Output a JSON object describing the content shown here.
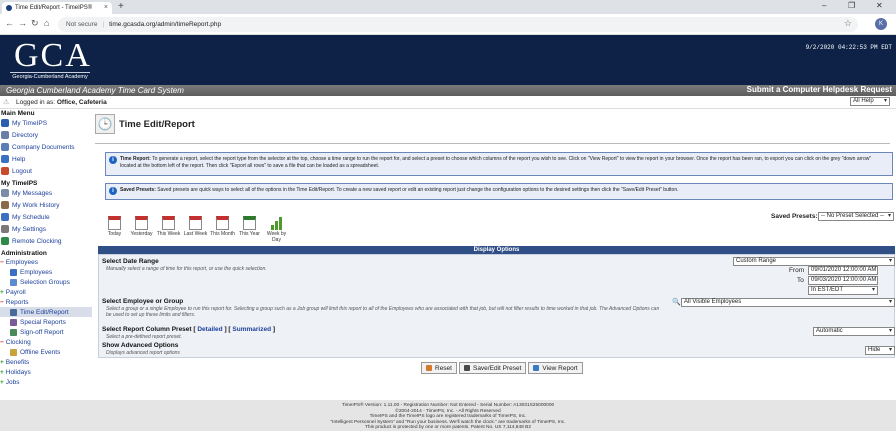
{
  "browser": {
    "tab_title": "Time Edit/Report - TimeIPS®",
    "tab_close": "×",
    "new_tab": "+",
    "win_min": "–",
    "win_max": "❐",
    "win_close": "✕",
    "back": "←",
    "forward": "→",
    "reload": "↻",
    "home": "⌂",
    "security": "Not secure",
    "url": "time.gcasda.org/admin/timeReport.php",
    "star": "☆",
    "profile_initial": "K"
  },
  "header": {
    "logo_text": "GCA",
    "logo_subtitle": "Georgia-Cumberland Academy",
    "datetime": "9/2/2020 04:22:53 PM EDT",
    "system_title": "Georgia Cumberland Academy Time Card System",
    "helpdesk_link": "Submit a Computer Helpdesk Request"
  },
  "login": {
    "warning": "⚠",
    "prefix": "Logged in as:",
    "user": "Office, Cafeteria",
    "help_select": "All Help"
  },
  "sidebar": {
    "main_menu": "Main Menu",
    "main_items": [
      {
        "label": "My TimeIPS",
        "color": "#2a5db0"
      },
      {
        "label": "Directory",
        "color": "#6a7fa8"
      },
      {
        "label": "Company Documents",
        "color": "#5b7fb5"
      },
      {
        "label": "Help",
        "color": "#3a6fc4"
      },
      {
        "label": "Logout",
        "color": "#c94a2a"
      }
    ],
    "my_timeips": "My TimeIPS",
    "my_items": [
      {
        "label": "My Messages",
        "color": "#7a8ca8"
      },
      {
        "label": "My Work History",
        "color": "#8a6a4a"
      },
      {
        "label": "My Schedule",
        "color": "#3a6fc4"
      },
      {
        "label": "My Settings",
        "color": "#7a7a7a"
      },
      {
        "label": "Remote Clocking",
        "color": "#2f8a4a"
      }
    ],
    "administration": "Administration",
    "employees": "Employees",
    "employees_sub": [
      "Employees",
      "Selection Groups"
    ],
    "payroll": "Payroll",
    "reports": "Reports",
    "reports_sub": [
      "Time Edit/Report",
      "Special Reports",
      "Sign-off Report"
    ],
    "clocking": "Clocking",
    "clocking_sub": [
      "Offline Events"
    ],
    "benefits": "Benefits",
    "holidays": "Holidays",
    "jobs": "Jobs"
  },
  "page": {
    "title": "Time Edit/Report",
    "info1_label": "Time Report:",
    "info1_text": "To generate a report, select the report type from the selector at the top, choose a time range to run the report for, and select a preset to choose which columns of the report you wish to see. Click on \"View Report\" to view the report in your browser. Once the report has been ran, to export you can click on the grey \"down arrow\" located at the bottom left of the report. Then click \"Export all rows\" to save a file that can be loaded as a spreadsheet.",
    "info2_label": "Saved Presets:",
    "info2_text": "Saved presets are quick ways to select all of the options in the Time Edit/Report. To create a new saved report or edit an existing report just change the configuration options to the desired settings then click the \"Save/Edit Preset\" button.",
    "presets": [
      {
        "label": "Today",
        "style": "red"
      },
      {
        "label": "Yesterday",
        "style": "red"
      },
      {
        "label": "This Week",
        "style": "red"
      },
      {
        "label": "Last Week",
        "style": "red"
      },
      {
        "label": "This Month",
        "style": "red"
      },
      {
        "label": "This Year",
        "style": "green"
      },
      {
        "label": "Week by Day",
        "style": "bars"
      }
    ],
    "saved_presets_label": "Saved Presets:",
    "saved_presets_value": "-- No Preset Selected --",
    "display_options": "Display Options",
    "date_range_label": "Select Date Range",
    "date_range_desc": "Manually select a range of time for this report, or use the quick selection.",
    "date_range_value": "Custom Range",
    "from_label": "From",
    "from_value": "09/01/2020 12:00:00 AM",
    "to_label": "To",
    "to_value": "09/03/2020 12:00:00 AM",
    "timezone_value": "In EST/EDT",
    "employee_label": "Select Employee or Group",
    "employee_desc": "Select a group or a single Employee to run this report for. Selecting a group such as a Job group will limit this report to all of the Employees who are associated with that job, but will not filter results to time worked in that job. The Advanced Options can be used to set up these limits and filters.",
    "employee_value": "All Visible Employees",
    "column_label": "Select Report Column Preset",
    "column_detailed": "Detailed",
    "column_summarized": "Summarized",
    "column_desc": "Select a pre-defined report preset.",
    "column_value": "Automatic",
    "advanced_label": "Show Advanced Options",
    "advanced_desc": "Displays advanced report options",
    "advanced_value": "Hide",
    "btn_reset": "Reset",
    "btn_save": "Save/Edit Preset",
    "btn_view": "View Report"
  },
  "footer": {
    "line1": "TimeIPS® Version: 1.11.00 - Registration Number: Not Entered - Serial Number: A13031S25000000",
    "line2": "©2004-2014 - TimeIPS, Inc. - All Rights Reserved",
    "line3": "TimeIPS and the TimeIPS logo are registered trademarks of TimeIPS, Inc.",
    "line4": "\"Intelligent Personnel System\" and \"Run your business. We'll watch the clock.\" are trademarks of TimeIPS, Inc.",
    "line5": "This product is protected by one or more patents. Patent No. US 7,114,848 B2"
  }
}
